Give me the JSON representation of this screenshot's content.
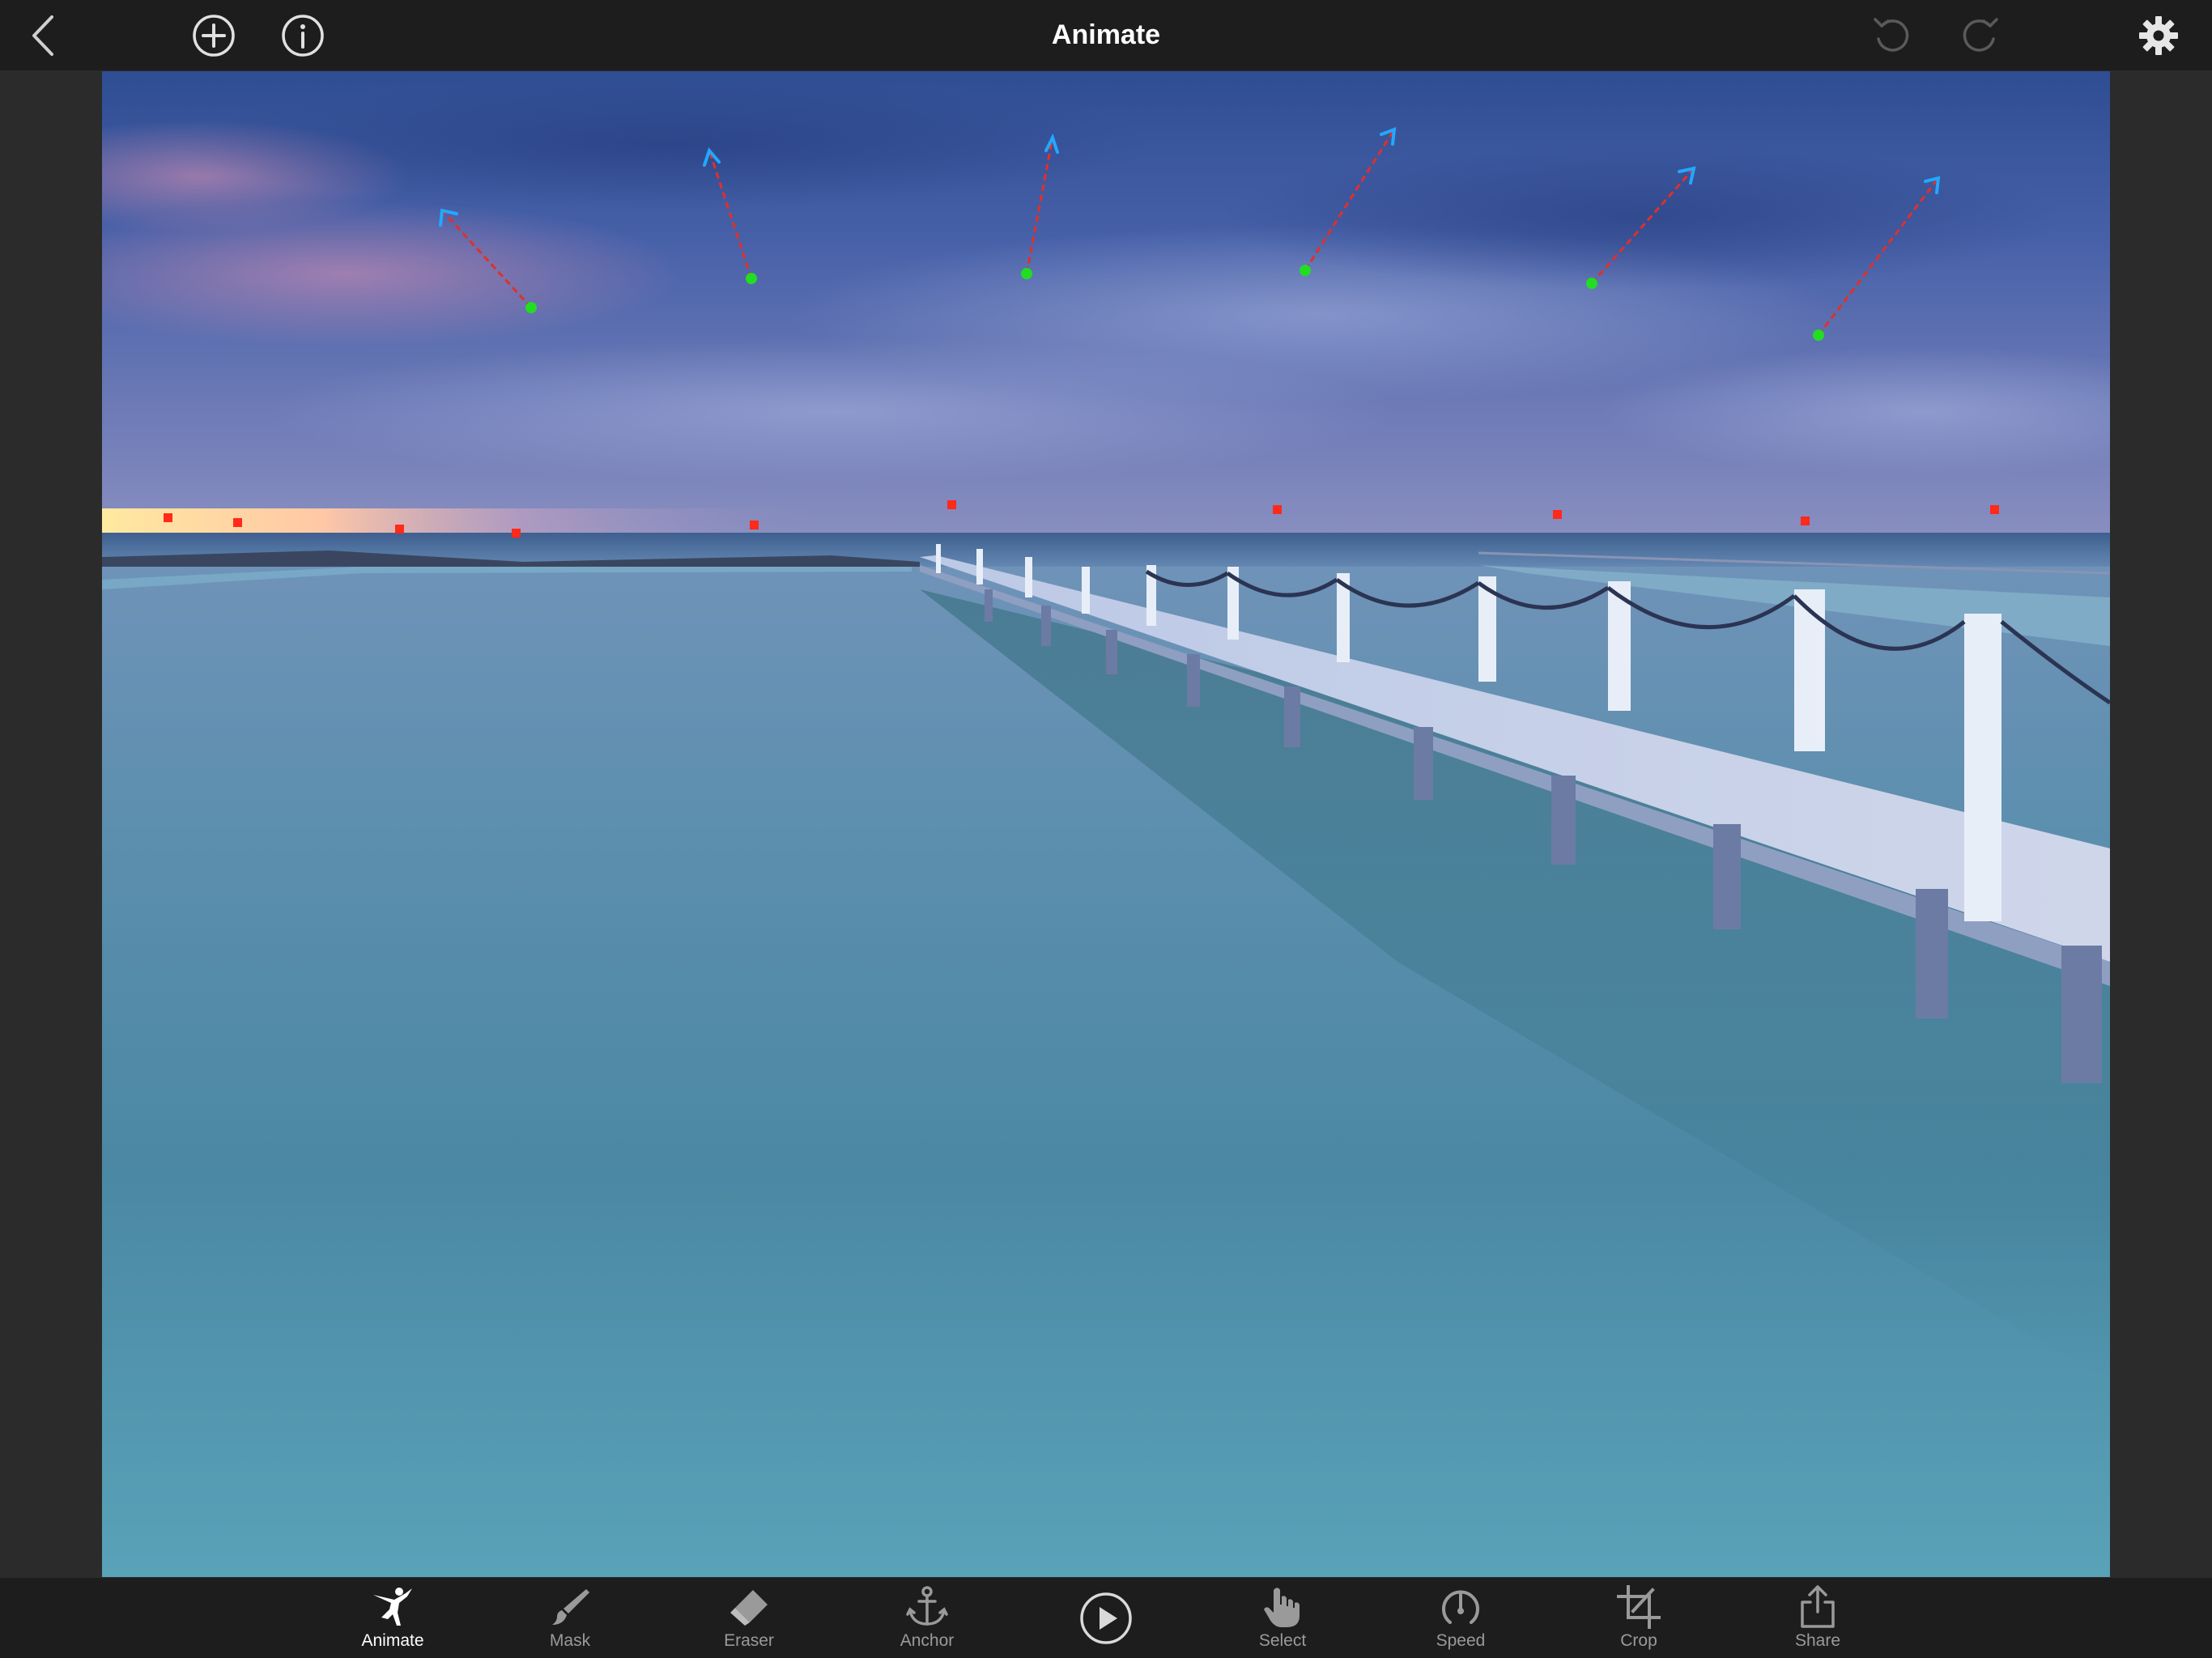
{
  "header": {
    "title": "Animate"
  },
  "toolbar": {
    "active_tool": "Animate",
    "tools": [
      {
        "id": "animate",
        "label": "Animate",
        "icon": "dancer-icon"
      },
      {
        "id": "mask",
        "label": "Mask",
        "icon": "brush-icon"
      },
      {
        "id": "eraser",
        "label": "Eraser",
        "icon": "eraser-icon"
      },
      {
        "id": "anchor",
        "label": "Anchor",
        "icon": "anchor-icon"
      },
      {
        "id": "select",
        "label": "Select",
        "icon": "hand-pointer-icon"
      },
      {
        "id": "speed",
        "label": "Speed",
        "icon": "speedometer-icon"
      },
      {
        "id": "crop",
        "label": "Crop",
        "icon": "crop-icon"
      },
      {
        "id": "share",
        "label": "Share",
        "icon": "share-icon"
      }
    ]
  },
  "colors": {
    "bar_bg": "#1d1d1d",
    "workspace_bg": "#2b2b2b",
    "anchor_point": "#ff2a1a",
    "motion_start": "#22dd22",
    "motion_line": "#e0302a",
    "motion_arrow": "#22a8ff",
    "icon_active": "#ffffff",
    "icon_inactive": "#9a9a9a",
    "icon_disabled": "#5a5a5a"
  }
}
